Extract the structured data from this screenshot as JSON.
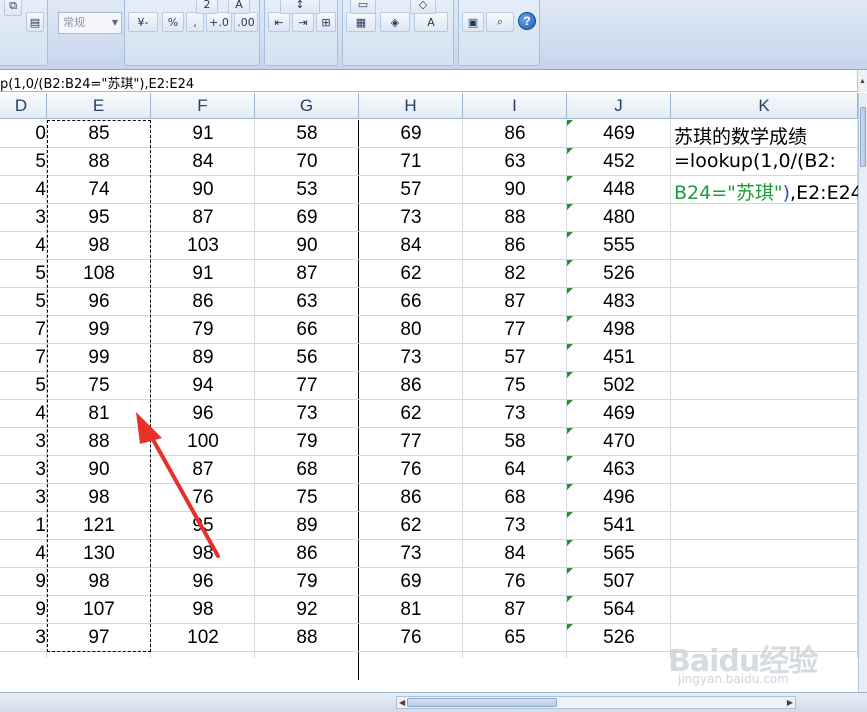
{
  "ribbon": {
    "number_format": "常规",
    "font_size_glyph": "2",
    "currency_glyph": "-",
    "percent_glyph": "%",
    "comma_glyph": ",",
    "increase_decimal_glyph": "+.0",
    "decrease_decimal_glyph": ".00",
    "help_glyph": "?"
  },
  "formula_bar": {
    "formula_prefix": "p(1,0/(",
    "formula_rest": "B2:B24=\"苏琪\"),E2:E24"
  },
  "columns": [
    "D",
    "E",
    "F",
    "G",
    "H",
    "I",
    "J",
    "K"
  ],
  "rows": [
    {
      "d": "0",
      "e": "85",
      "f": "91",
      "g": "58",
      "h": "69",
      "i": "86",
      "j": "469"
    },
    {
      "d": "5",
      "e": "88",
      "f": "84",
      "g": "70",
      "h": "71",
      "i": "63",
      "j": "452"
    },
    {
      "d": "4",
      "e": "74",
      "f": "90",
      "g": "53",
      "h": "57",
      "i": "90",
      "j": "448"
    },
    {
      "d": "3",
      "e": "95",
      "f": "87",
      "g": "69",
      "h": "73",
      "i": "88",
      "j": "480"
    },
    {
      "d": "4",
      "e": "98",
      "f": "103",
      "g": "90",
      "h": "84",
      "i": "86",
      "j": "555"
    },
    {
      "d": "5",
      "e": "108",
      "f": "91",
      "g": "87",
      "h": "62",
      "i": "82",
      "j": "526"
    },
    {
      "d": "5",
      "e": "96",
      "f": "86",
      "g": "63",
      "h": "66",
      "i": "87",
      "j": "483"
    },
    {
      "d": "7",
      "e": "99",
      "f": "79",
      "g": "66",
      "h": "80",
      "i": "77",
      "j": "498"
    },
    {
      "d": "7",
      "e": "99",
      "f": "89",
      "g": "56",
      "h": "73",
      "i": "57",
      "j": "451"
    },
    {
      "d": "5",
      "e": "75",
      "f": "94",
      "g": "77",
      "h": "86",
      "i": "75",
      "j": "502"
    },
    {
      "d": "4",
      "e": "81",
      "f": "96",
      "g": "73",
      "h": "62",
      "i": "73",
      "j": "469"
    },
    {
      "d": "3",
      "e": "88",
      "f": "100",
      "g": "79",
      "h": "77",
      "i": "58",
      "j": "470"
    },
    {
      "d": "3",
      "e": "90",
      "f": "87",
      "g": "68",
      "h": "76",
      "i": "64",
      "j": "463"
    },
    {
      "d": "3",
      "e": "98",
      "f": "76",
      "g": "75",
      "h": "86",
      "i": "68",
      "j": "496"
    },
    {
      "d": "1",
      "e": "121",
      "f": "95",
      "g": "89",
      "h": "62",
      "i": "73",
      "j": "541"
    },
    {
      "d": "4",
      "e": "130",
      "f": "98",
      "g": "86",
      "h": "73",
      "i": "84",
      "j": "565"
    },
    {
      "d": "9",
      "e": "98",
      "f": "96",
      "g": "79",
      "h": "69",
      "i": "76",
      "j": "507"
    },
    {
      "d": "9",
      "e": "107",
      "f": "98",
      "g": "92",
      "h": "81",
      "i": "87",
      "j": "564"
    },
    {
      "d": "3",
      "e": "97",
      "f": "102",
      "g": "88",
      "h": "76",
      "i": "65",
      "j": "526"
    }
  ],
  "k_column": {
    "line1": "苏琪的数学成绩",
    "line2": "=lookup(1,0/(B2:",
    "line3_a": "B24=\"苏琪\"",
    "line3_b": ")",
    "line3_c": ",E2:E24"
  },
  "watermark": {
    "logo": "Baidu经验",
    "url": "jingyan.baidu.com"
  },
  "colors": {
    "accent_green": "#1e9b3a",
    "accent_blue": "#2b4fd6",
    "arrow_red": "#e8302a"
  }
}
